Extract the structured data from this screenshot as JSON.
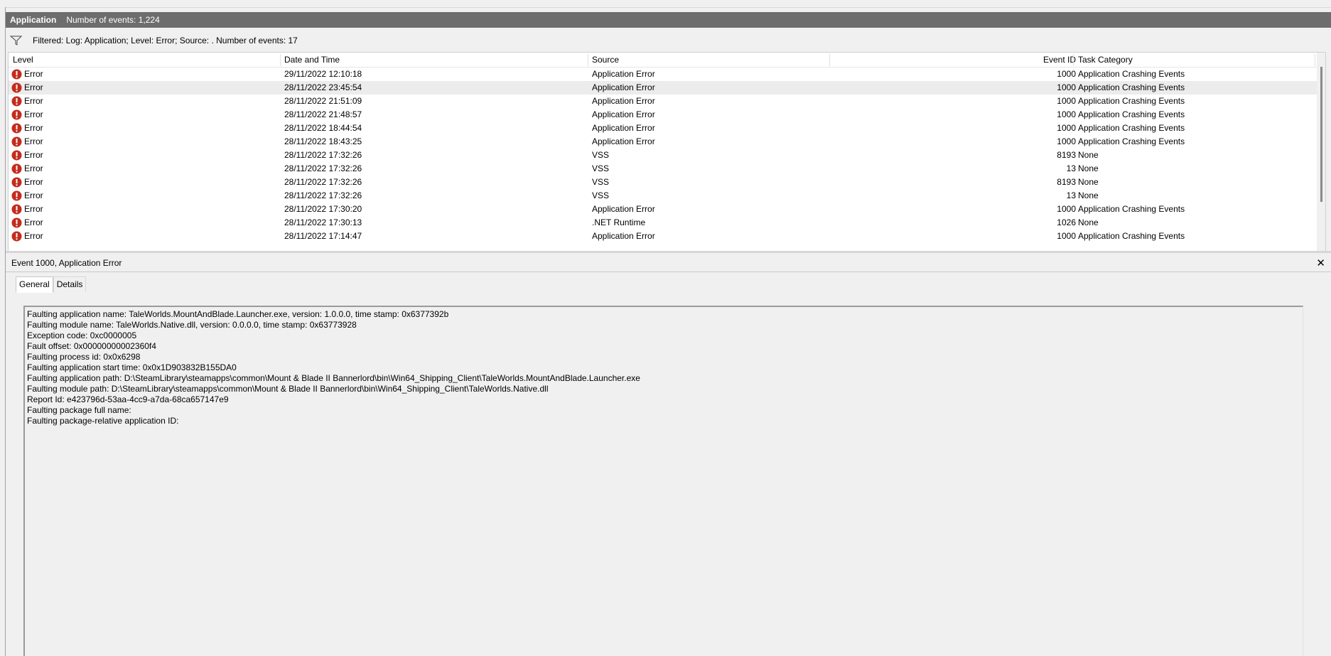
{
  "header": {
    "log_name": "Application",
    "event_count": "Number of events: 1,224"
  },
  "filter": {
    "icon": "filter-icon",
    "text": "Filtered: Log: Application; Level: Error; Source: . Number of events: 17"
  },
  "columns": {
    "level": "Level",
    "date": "Date and Time",
    "source": "Source",
    "event_id": "Event ID",
    "category": "Task Category"
  },
  "rows": [
    {
      "level": "Error",
      "date": "29/11/2022 12:10:18",
      "source": "Application Error",
      "event_id": "1000",
      "category": "Application Crashing Events"
    },
    {
      "level": "Error",
      "date": "28/11/2022 23:45:54",
      "source": "Application Error",
      "event_id": "1000",
      "category": "Application Crashing Events"
    },
    {
      "level": "Error",
      "date": "28/11/2022 21:51:09",
      "source": "Application Error",
      "event_id": "1000",
      "category": "Application Crashing Events"
    },
    {
      "level": "Error",
      "date": "28/11/2022 21:48:57",
      "source": "Application Error",
      "event_id": "1000",
      "category": "Application Crashing Events"
    },
    {
      "level": "Error",
      "date": "28/11/2022 18:44:54",
      "source": "Application Error",
      "event_id": "1000",
      "category": "Application Crashing Events"
    },
    {
      "level": "Error",
      "date": "28/11/2022 18:43:25",
      "source": "Application Error",
      "event_id": "1000",
      "category": "Application Crashing Events"
    },
    {
      "level": "Error",
      "date": "28/11/2022 17:32:26",
      "source": "VSS",
      "event_id": "8193",
      "category": "None"
    },
    {
      "level": "Error",
      "date": "28/11/2022 17:32:26",
      "source": "VSS",
      "event_id": "13",
      "category": "None"
    },
    {
      "level": "Error",
      "date": "28/11/2022 17:32:26",
      "source": "VSS",
      "event_id": "8193",
      "category": "None"
    },
    {
      "level": "Error",
      "date": "28/11/2022 17:32:26",
      "source": "VSS",
      "event_id": "13",
      "category": "None"
    },
    {
      "level": "Error",
      "date": "28/11/2022 17:30:20",
      "source": "Application Error",
      "event_id": "1000",
      "category": "Application Crashing Events"
    },
    {
      "level": "Error",
      "date": "28/11/2022 17:30:13",
      "source": ".NET Runtime",
      "event_id": "1026",
      "category": "None"
    },
    {
      "level": "Error",
      "date": "28/11/2022 17:14:47",
      "source": "Application Error",
      "event_id": "1000",
      "category": "Application Crashing Events"
    }
  ],
  "detail": {
    "title": "Event 1000, Application Error",
    "close_label": "✕",
    "tabs": [
      "General",
      "Details"
    ],
    "lines": [
      "Faulting application name: TaleWorlds.MountAndBlade.Launcher.exe, version: 1.0.0.0, time stamp: 0x6377392b",
      "Faulting module name: TaleWorlds.Native.dll, version: 0.0.0.0, time stamp: 0x63773928",
      "Exception code: 0xc0000005",
      "Fault offset: 0x00000000002360f4",
      "Faulting process id: 0x0x6298",
      "Faulting application start time: 0x0x1D903832B155DA0",
      "Faulting application path: D:\\SteamLibrary\\steamapps\\common\\Mount & Blade II Bannerlord\\bin\\Win64_Shipping_Client\\TaleWorlds.MountAndBlade.Launcher.exe",
      "Faulting module path: D:\\SteamLibrary\\steamapps\\common\\Mount & Blade II Bannerlord\\bin\\Win64_Shipping_Client\\TaleWorlds.Native.dll",
      "Report Id: e423796d-53aa-4cc9-a7da-68ca657147e9",
      "Faulting package full name:",
      "Faulting package-relative application ID:"
    ]
  },
  "colors": {
    "header_bg": "#6d6d6d",
    "error_icon": "#c42b1c",
    "selected_row": "#ececec"
  }
}
